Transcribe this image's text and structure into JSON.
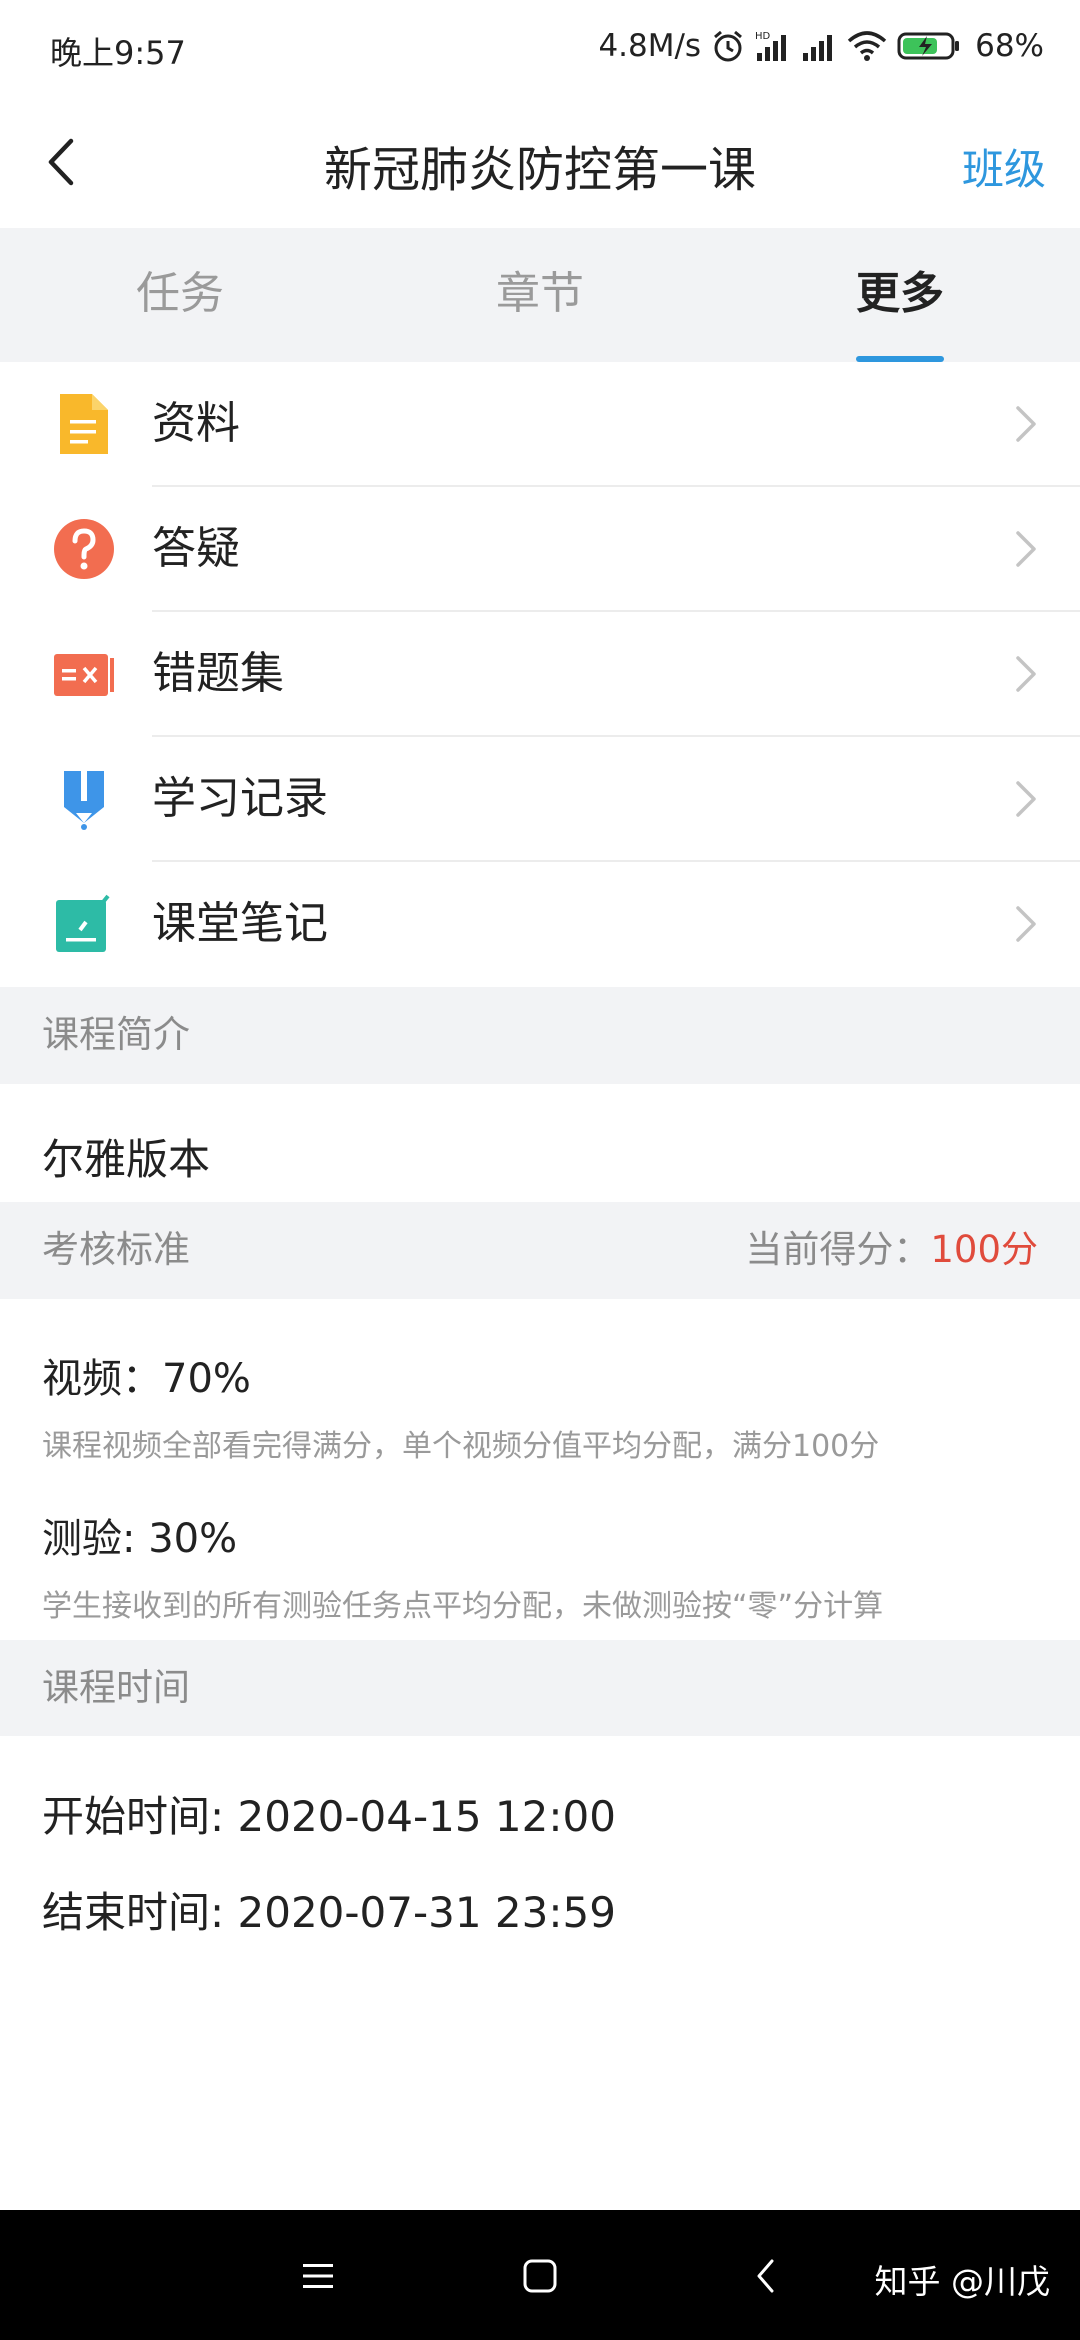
{
  "status_bar": {
    "time": "晚上9:57",
    "speed": "4.8M/s",
    "hd_label": "HD",
    "battery": "68%",
    "icons": [
      "alarm-icon",
      "signal-hd-icon",
      "signal-icon",
      "wifi-icon",
      "battery-charging-icon"
    ]
  },
  "nav": {
    "back_icon": "chevron-left-icon",
    "title": "新冠肺炎防控第一课",
    "right_link": "班级"
  },
  "tabs": [
    {
      "label": "任务",
      "active": false
    },
    {
      "label": "章节",
      "active": false
    },
    {
      "label": "更多",
      "active": true
    }
  ],
  "menu": [
    {
      "label": "资料",
      "icon": "document-icon",
      "color": "#f9b82b"
    },
    {
      "label": "答疑",
      "icon": "question-icon",
      "color": "#f26d50"
    },
    {
      "label": "错题集",
      "icon": "wrong-answers-icon",
      "color": "#f26d50"
    },
    {
      "label": "学习记录",
      "icon": "study-record-icon",
      "color": "#3e95e8"
    },
    {
      "label": "课堂笔记",
      "icon": "notes-icon",
      "color": "#2dbba6"
    }
  ],
  "intro": {
    "header": "课程简介",
    "text": "尔雅版本"
  },
  "assessment": {
    "header": "考核标准",
    "score_label": "当前得分：",
    "score_value": "100分",
    "items": [
      {
        "title": "视频：70%",
        "desc": "课程视频全部看完得满分，单个视频分值平均分配，满分100分"
      },
      {
        "title": "测验: 30%",
        "desc": "学生接收到的所有测验任务点平均分配，未做测验按“零”分计算"
      }
    ]
  },
  "schedule": {
    "header": "课程时间",
    "start": "开始时间: 2020-04-15 12:00",
    "end": "结束时间: 2020-07-31 23:59"
  },
  "system_nav": {
    "icons": [
      "menu-icon",
      "home-icon",
      "back-icon"
    ],
    "watermark": "知乎 @川戊"
  },
  "colors": {
    "accent": "#2e97de",
    "score": "#e04b3c",
    "section_bg": "#f2f3f5"
  }
}
